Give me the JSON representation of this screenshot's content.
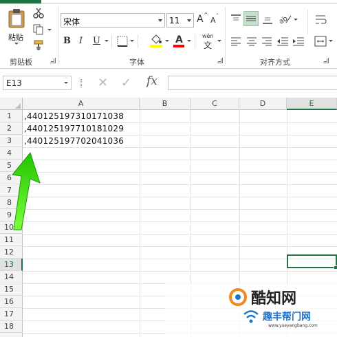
{
  "ribbon": {
    "clipboard": {
      "paste_label": "粘贴",
      "group_label": "剪贴板"
    },
    "font": {
      "font_name": "宋体",
      "font_size": "11",
      "bold": "B",
      "italic": "I",
      "underline": "U",
      "font_color_glyph": "A",
      "phonetic_glyph": "wén",
      "phonetic_char": "文",
      "group_label": "字体"
    },
    "alignment": {
      "group_label": "对齐方式"
    }
  },
  "formula_bar": {
    "name_box": "E13",
    "cancel_glyph": "✕",
    "enter_glyph": "✓",
    "fx_label": "fx",
    "formula": ""
  },
  "sheet": {
    "columns": [
      "A",
      "B",
      "C",
      "D",
      "E"
    ],
    "selected_column": "E",
    "rows": [
      "1",
      "2",
      "3",
      "4",
      "5",
      "6",
      "7",
      "8",
      "9",
      "10",
      "11",
      "12",
      "13",
      "14",
      "15",
      "16",
      "17",
      "18"
    ],
    "selected_row": "13",
    "cells": [
      {
        "row": 1,
        "col": "A",
        "value": ",440125197310171038"
      },
      {
        "row": 2,
        "col": "A",
        "value": ",440125197710181029"
      },
      {
        "row": 3,
        "col": "A",
        "value": ",440125197702041036"
      }
    ]
  },
  "watermark": {
    "title": "酷知网",
    "subtitle": "趣丰帮门网",
    "url": "www.yueyangbang.com"
  },
  "colors": {
    "excel_green": "#217346",
    "annotation_arrow": "#2fd400",
    "watermark_orange": "#f08a1e",
    "watermark_blue": "#1e73c8"
  }
}
